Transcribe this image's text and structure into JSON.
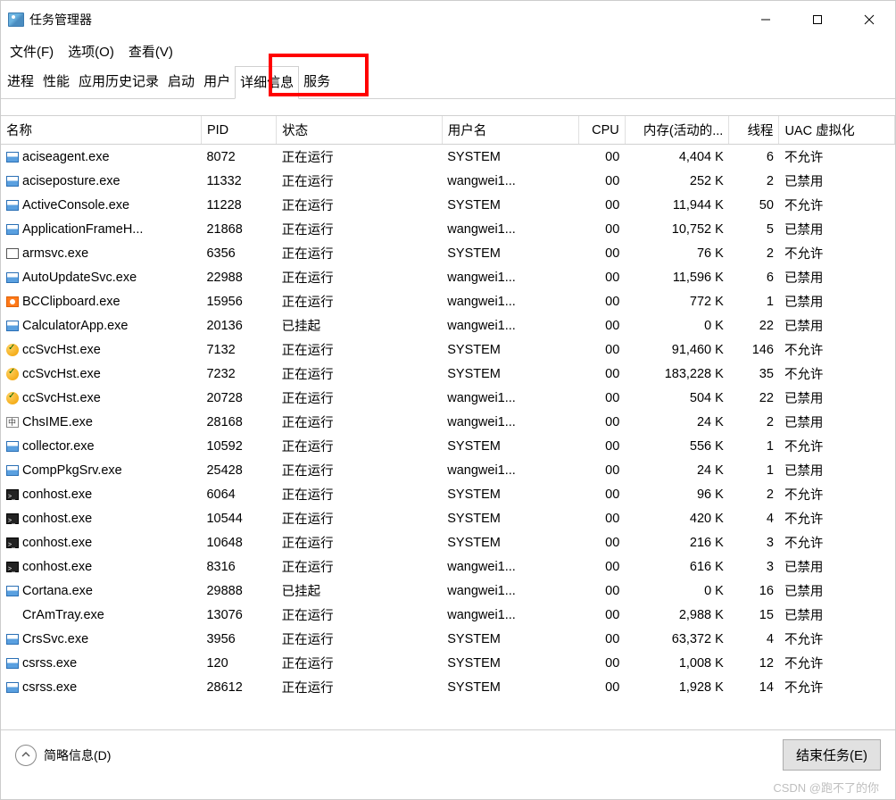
{
  "window": {
    "title": "任务管理器",
    "min_tooltip": "Minimize",
    "max_tooltip": "Maximize",
    "close_tooltip": "Close"
  },
  "menu": {
    "file": "文件(F)",
    "options": "选项(O)",
    "view": "查看(V)"
  },
  "tabs": {
    "processes": "进程",
    "performance": "性能",
    "app_history": "应用历史记录",
    "startup": "启动",
    "users": "用户",
    "details": "详细信息",
    "services": "服务"
  },
  "columns": {
    "name": "名称",
    "pid": "PID",
    "status": "状态",
    "user": "用户名",
    "cpu": "CPU",
    "memory": "内存(活动的...",
    "threads": "线程",
    "uac": "UAC 虚拟化"
  },
  "status_values": {
    "running": "正在运行",
    "suspended": "已挂起"
  },
  "uac_values": {
    "not_allowed": "不允许",
    "disabled": "已禁用"
  },
  "processes": [
    {
      "icon": "win",
      "name": "aciseagent.exe",
      "pid": "8072",
      "status": "正在运行",
      "user": "SYSTEM",
      "cpu": "00",
      "mem": "4,404 K",
      "threads": "6",
      "uac": "不允许"
    },
    {
      "icon": "win",
      "name": "aciseposture.exe",
      "pid": "11332",
      "status": "正在运行",
      "user": "wangwei1...",
      "cpu": "00",
      "mem": "252 K",
      "threads": "2",
      "uac": "已禁用"
    },
    {
      "icon": "win",
      "name": "ActiveConsole.exe",
      "pid": "11228",
      "status": "正在运行",
      "user": "SYSTEM",
      "cpu": "00",
      "mem": "11,944 K",
      "threads": "50",
      "uac": "不允许"
    },
    {
      "icon": "win",
      "name": "ApplicationFrameH...",
      "pid": "21868",
      "status": "正在运行",
      "user": "wangwei1...",
      "cpu": "00",
      "mem": "10,752 K",
      "threads": "5",
      "uac": "已禁用"
    },
    {
      "icon": "blank",
      "name": "armsvc.exe",
      "pid": "6356",
      "status": "正在运行",
      "user": "SYSTEM",
      "cpu": "00",
      "mem": "76 K",
      "threads": "2",
      "uac": "不允许"
    },
    {
      "icon": "win",
      "name": "AutoUpdateSvc.exe",
      "pid": "22988",
      "status": "正在运行",
      "user": "wangwei1...",
      "cpu": "00",
      "mem": "11,596 K",
      "threads": "6",
      "uac": "已禁用"
    },
    {
      "icon": "clip",
      "name": "BCClipboard.exe",
      "pid": "15956",
      "status": "正在运行",
      "user": "wangwei1...",
      "cpu": "00",
      "mem": "772 K",
      "threads": "1",
      "uac": "已禁用"
    },
    {
      "icon": "win",
      "name": "CalculatorApp.exe",
      "pid": "20136",
      "status": "已挂起",
      "user": "wangwei1...",
      "cpu": "00",
      "mem": "0 K",
      "threads": "22",
      "uac": "已禁用"
    },
    {
      "icon": "orange",
      "name": "ccSvcHst.exe",
      "pid": "7132",
      "status": "正在运行",
      "user": "SYSTEM",
      "cpu": "00",
      "mem": "91,460 K",
      "threads": "146",
      "uac": "不允许"
    },
    {
      "icon": "orange",
      "name": "ccSvcHst.exe",
      "pid": "7232",
      "status": "正在运行",
      "user": "SYSTEM",
      "cpu": "00",
      "mem": "183,228 K",
      "threads": "35",
      "uac": "不允许"
    },
    {
      "icon": "orange",
      "name": "ccSvcHst.exe",
      "pid": "20728",
      "status": "正在运行",
      "user": "wangwei1...",
      "cpu": "00",
      "mem": "504 K",
      "threads": "22",
      "uac": "已禁用"
    },
    {
      "icon": "ime",
      "name": "ChsIME.exe",
      "pid": "28168",
      "status": "正在运行",
      "user": "wangwei1...",
      "cpu": "00",
      "mem": "24 K",
      "threads": "2",
      "uac": "已禁用"
    },
    {
      "icon": "win",
      "name": "collector.exe",
      "pid": "10592",
      "status": "正在运行",
      "user": "SYSTEM",
      "cpu": "00",
      "mem": "556 K",
      "threads": "1",
      "uac": "不允许"
    },
    {
      "icon": "win",
      "name": "CompPkgSrv.exe",
      "pid": "25428",
      "status": "正在运行",
      "user": "wangwei1...",
      "cpu": "00",
      "mem": "24 K",
      "threads": "1",
      "uac": "已禁用"
    },
    {
      "icon": "term",
      "name": "conhost.exe",
      "pid": "6064",
      "status": "正在运行",
      "user": "SYSTEM",
      "cpu": "00",
      "mem": "96 K",
      "threads": "2",
      "uac": "不允许"
    },
    {
      "icon": "term",
      "name": "conhost.exe",
      "pid": "10544",
      "status": "正在运行",
      "user": "SYSTEM",
      "cpu": "00",
      "mem": "420 K",
      "threads": "4",
      "uac": "不允许"
    },
    {
      "icon": "term",
      "name": "conhost.exe",
      "pid": "10648",
      "status": "正在运行",
      "user": "SYSTEM",
      "cpu": "00",
      "mem": "216 K",
      "threads": "3",
      "uac": "不允许"
    },
    {
      "icon": "term",
      "name": "conhost.exe",
      "pid": "8316",
      "status": "正在运行",
      "user": "wangwei1...",
      "cpu": "00",
      "mem": "616 K",
      "threads": "3",
      "uac": "已禁用"
    },
    {
      "icon": "win",
      "name": "Cortana.exe",
      "pid": "29888",
      "status": "已挂起",
      "user": "wangwei1...",
      "cpu": "00",
      "mem": "0 K",
      "threads": "16",
      "uac": "已禁用"
    },
    {
      "icon": "none",
      "name": "CrAmTray.exe",
      "pid": "13076",
      "status": "正在运行",
      "user": "wangwei1...",
      "cpu": "00",
      "mem": "2,988 K",
      "threads": "15",
      "uac": "已禁用"
    },
    {
      "icon": "win",
      "name": "CrsSvc.exe",
      "pid": "3956",
      "status": "正在运行",
      "user": "SYSTEM",
      "cpu": "00",
      "mem": "63,372 K",
      "threads": "4",
      "uac": "不允许"
    },
    {
      "icon": "win",
      "name": "csrss.exe",
      "pid": "120",
      "status": "正在运行",
      "user": "SYSTEM",
      "cpu": "00",
      "mem": "1,008 K",
      "threads": "12",
      "uac": "不允许"
    },
    {
      "icon": "win",
      "name": "csrss.exe",
      "pid": "28612",
      "status": "正在运行",
      "user": "SYSTEM",
      "cpu": "00",
      "mem": "1,928 K",
      "threads": "14",
      "uac": "不允许"
    }
  ],
  "footer": {
    "fewer_details": "简略信息(D)",
    "end_task": "结束任务(E)"
  },
  "watermark": "CSDN @跑不了的你"
}
